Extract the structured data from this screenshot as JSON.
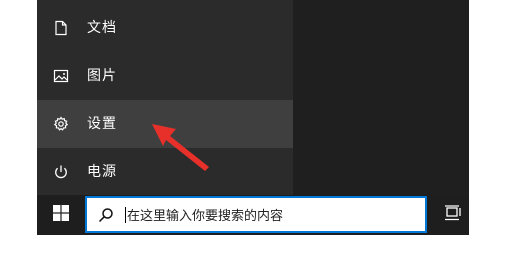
{
  "start_menu": {
    "items": [
      {
        "label": "文档",
        "icon": "document-icon"
      },
      {
        "label": "图片",
        "icon": "pictures-icon"
      },
      {
        "label": "设置",
        "icon": "gear-icon",
        "highlighted": true
      },
      {
        "label": "电源",
        "icon": "power-icon"
      }
    ]
  },
  "taskbar": {
    "start_icon": "windows-logo-icon",
    "search": {
      "icon": "search-icon",
      "placeholder": "在这里输入你要搜索的内容"
    },
    "task_view_icon": "task-view-icon"
  },
  "annotation": {
    "arrow_color": "#e8302a",
    "points_to": "设置"
  },
  "colors": {
    "panel_bg": "#2b2b2b",
    "hover_bg": "#3f3f3f",
    "taskbar_bg": "#1e1e1e",
    "search_border": "#0078d7"
  }
}
